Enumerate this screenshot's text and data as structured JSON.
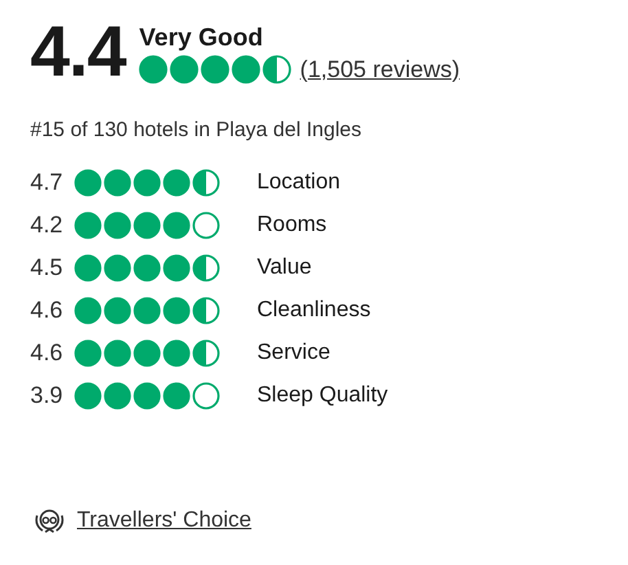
{
  "overall": {
    "score": "4.4",
    "label": "Very Good",
    "stars": 4.5,
    "reviews": "(1,505 reviews)"
  },
  "ranking": "#15 of 130 hotels in Playa del Ingles",
  "subratings": [
    {
      "score": "4.7",
      "stars": 4.5,
      "label": "Location"
    },
    {
      "score": "4.2",
      "stars": 4,
      "label": "Rooms"
    },
    {
      "score": "4.5",
      "stars": 4.5,
      "label": "Value"
    },
    {
      "score": "4.6",
      "stars": 4.5,
      "label": "Cleanliness"
    },
    {
      "score": "4.6",
      "stars": 4.5,
      "label": "Service"
    },
    {
      "score": "3.9",
      "stars": 4,
      "label": "Sleep Quality"
    }
  ],
  "award": {
    "label": "Travellers' Choice"
  }
}
